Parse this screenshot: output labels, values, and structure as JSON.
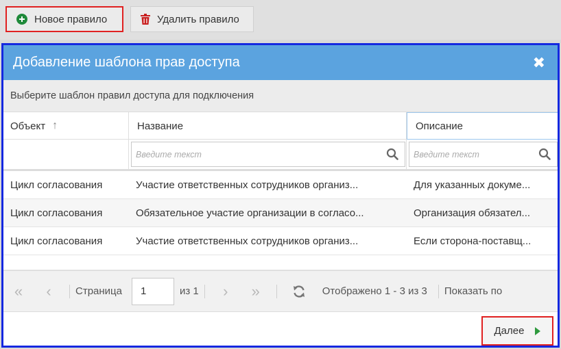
{
  "toolbar": {
    "new_rule_label": "Новое правило",
    "delete_rule_label": "Удалить правило"
  },
  "dialog": {
    "title": "Добавление шаблона прав доступа",
    "close_glyph": "✖",
    "subtitle": "Выберите шаблон правил доступа для подключения",
    "columns": {
      "object": "Объект",
      "sort_glyph": "↑",
      "name": "Название",
      "description": "Описание"
    },
    "filter_placeholder": "Введите текст",
    "rows": [
      {
        "object": "Цикл согласования",
        "name": "Участие ответственных сотрудников организ...",
        "description": "Для указанных докуме..."
      },
      {
        "object": "Цикл согласования",
        "name": "Обязательное участие организации в согласо...",
        "description": "Организация обязател..."
      },
      {
        "object": "Цикл согласования",
        "name": "Участие ответственных сотрудников организ...",
        "description": "Если сторона-поставщ..."
      }
    ],
    "pager": {
      "first_glyph": "«",
      "prev_glyph": "‹",
      "page_label": "Страница",
      "page_value": "1",
      "of_label": "из 1",
      "next_glyph": "›",
      "last_glyph": "»",
      "displayed_text": "Отображено 1 - 3 из 3",
      "show_text": "Показать по"
    },
    "next_label": "Далее"
  },
  "colors": {
    "header": "#5ba3df",
    "dialog_border": "#1428e0",
    "highlight": "#e02020",
    "accent_green": "#2f9a3e"
  }
}
